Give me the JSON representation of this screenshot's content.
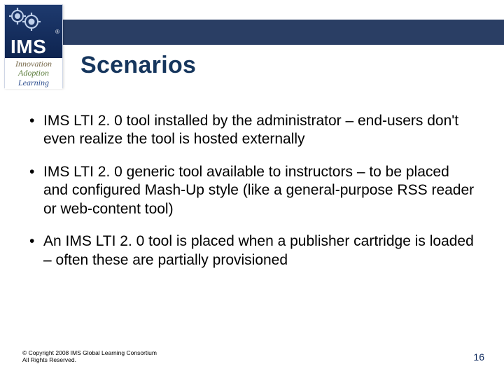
{
  "logo": {
    "acronym": "IMS",
    "registered": "®",
    "tag_innovation": "Innovation",
    "tag_adoption": "Adoption",
    "tag_learning": "Learning"
  },
  "title": "Scenarios",
  "bullets": [
    "IMS LTI 2. 0 tool installed by the administrator – end-users don't even realize the tool is hosted externally",
    "IMS LTI 2. 0 generic tool available to instructors – to be placed and configured Mash-Up style (like a general-purpose RSS reader or web-content tool)",
    "An IMS LTI 2. 0 tool is placed when a publisher cartridge is loaded – often these are partially provisioned"
  ],
  "footer": {
    "line1": "© Copyright 2008  IMS Global Learning Consortium",
    "line2": "All Rights Reserved."
  },
  "page_number": "16"
}
